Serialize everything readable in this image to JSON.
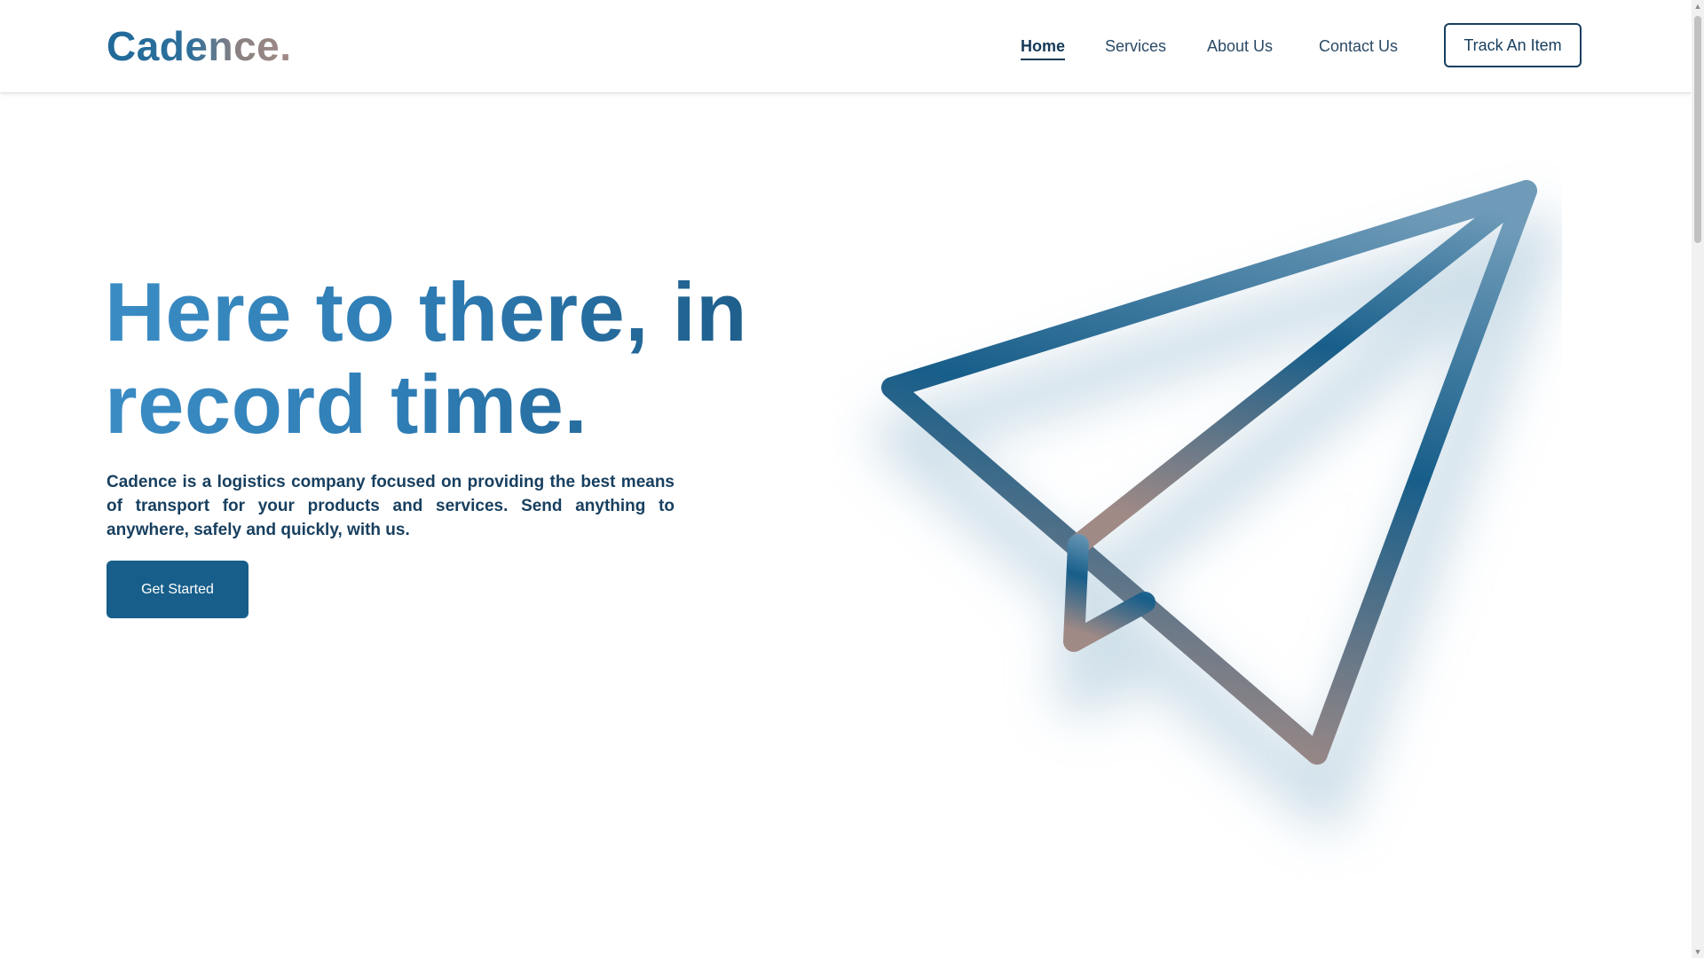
{
  "header": {
    "logo": "Cadence.",
    "nav": [
      {
        "label": "Home",
        "active": true
      },
      {
        "label": "Services",
        "active": false
      },
      {
        "label": "About Us",
        "active": false
      },
      {
        "label": "Contact Us",
        "active": false
      }
    ],
    "track_button": "Track An Item"
  },
  "hero": {
    "title": "Here to there, in record time.",
    "description": "Cadence is a logistics company focused on providing the best means of transport for your products and services. Send anything to anywhere, safely and quickly, with us.",
    "cta_button": "Get Started"
  },
  "illustration": {
    "icon": "paper-plane-icon",
    "gradient_top": "#6f9bb8",
    "gradient_mid": "#175e8a",
    "gradient_bottom": "#a08a86",
    "glow_color": "#a9c6d8"
  },
  "scrollbar": {
    "up_icon": "triangle-up-icon",
    "down_icon": "triangle-down-icon"
  },
  "colors": {
    "brand_primary": "#175e8a",
    "brand_dark": "#173f5f",
    "title_light": "#3b8cc4",
    "accent_warm": "#a08a86"
  }
}
